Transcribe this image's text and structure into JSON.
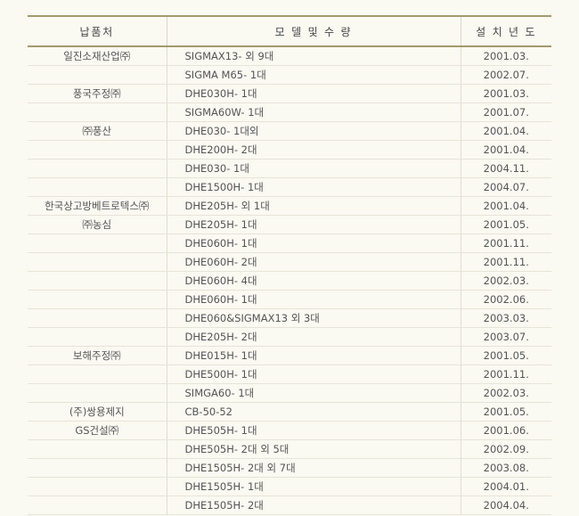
{
  "headers": {
    "client": "납품처",
    "model": "모 델 및 수 량",
    "date": "설 치 년 도"
  },
  "rows": [
    {
      "client": "일진소재산업㈜",
      "model": "SIGMAX13- 외 9대",
      "date": "2001.03."
    },
    {
      "client": "",
      "model": "SIGMA M65- 1대",
      "date": "2002.07."
    },
    {
      "client": "풍국주정㈜",
      "model": "DHE030H- 1대",
      "date": "2001.03."
    },
    {
      "client": "",
      "model": "SIGMA60W- 1대",
      "date": "2001.07."
    },
    {
      "client": "㈜풍산",
      "model": "DHE030- 1대외",
      "date": "2001.04."
    },
    {
      "client": "",
      "model": "DHE200H- 2대",
      "date": "2001.04."
    },
    {
      "client": "",
      "model": "DHE030- 1대",
      "date": "2004.11."
    },
    {
      "client": "",
      "model": "DHE1500H- 1대",
      "date": "2004.07."
    },
    {
      "client": "한국상고방베트로텍스㈜",
      "model": "DHE205H- 외 1대",
      "date": "2001.04."
    },
    {
      "client": "㈜농심",
      "model": "DHE205H- 1대",
      "date": "2001.05."
    },
    {
      "client": "",
      "model": "DHE060H- 1대",
      "date": "2001.11."
    },
    {
      "client": "",
      "model": "DHE060H- 2대",
      "date": "2001.11."
    },
    {
      "client": "",
      "model": "DHE060H- 4대",
      "date": "2002.03."
    },
    {
      "client": "",
      "model": "DHE060H- 1대",
      "date": "2002.06."
    },
    {
      "client": "",
      "model": "DHE060&SIGMAX13 외 3대",
      "date": "2003.03."
    },
    {
      "client": "",
      "model": "DHE205H- 2대",
      "date": "2003.07."
    },
    {
      "client": "보해주정㈜",
      "model": "DHE015H- 1대",
      "date": "2001.05."
    },
    {
      "client": "",
      "model": "DHE500H- 1대",
      "date": "2001.11."
    },
    {
      "client": "",
      "model": "SIMGA60- 1대",
      "date": "2002.03."
    },
    {
      "client": "(주)쌍용제지",
      "model": "CB-50-52",
      "date": "2001.05."
    },
    {
      "client": "GS건설㈜",
      "model": "DHE505H- 1대",
      "date": "2001.06."
    },
    {
      "client": "",
      "model": "DHE505H- 2대 외 5대",
      "date": "2002.09."
    },
    {
      "client": "",
      "model": "DHE1505H- 2대 외 7대",
      "date": "2003.08."
    },
    {
      "client": "",
      "model": "DHE1505H- 1대",
      "date": "2004.01."
    },
    {
      "client": "",
      "model": "DHE1505H- 2대",
      "date": "2004.04."
    }
  ]
}
